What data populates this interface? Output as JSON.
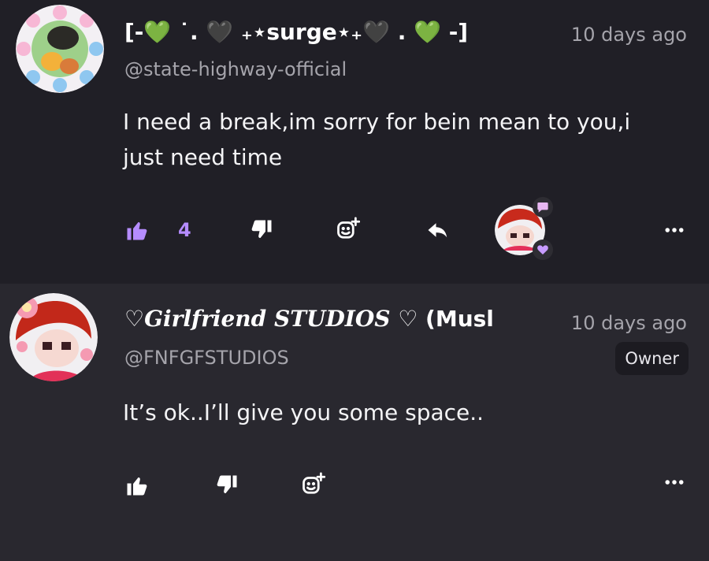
{
  "comments": [
    {
      "author_name": "[-💚 ˙. 🖤 ₊⋆surge⋆₊🖤 . 💚 -]",
      "handle": "@state-highway-official",
      "time": "10 days ago",
      "text_line1": "I need a break,im sorry for bein mean to you,i",
      "text_line2": "just need time",
      "like_count": "4"
    },
    {
      "author_prefix": "♡",
      "author_fancy": "Girlfriend STUDIOS",
      "author_suffix": " ♡ (Musl",
      "handle": "@FNFGFSTUDIOS",
      "time": "10 days ago",
      "badge": "Owner",
      "text": "It’s ok..I’ll give you some space.."
    }
  ],
  "colors": {
    "accent": "#b58cff",
    "background": "#201f26",
    "second_background": "#29282f",
    "muted_text": "#a5a4ab"
  },
  "icons": [
    "thumbs-up-icon",
    "thumbs-down-icon",
    "add-reaction-icon",
    "reply-icon",
    "more-options-icon",
    "heart-icon",
    "chat-bubble-icon"
  ]
}
